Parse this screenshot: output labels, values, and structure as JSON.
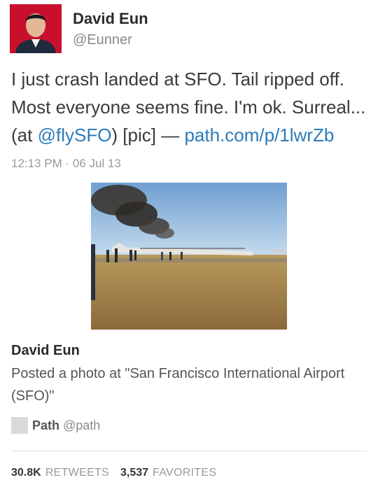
{
  "tweet": {
    "author_name": "David Eun",
    "author_handle": "@Eunner",
    "text_line1": "I just crash landed at SFO. Tail ripped off.",
    "text_line2": "Most everyone seems fine. I'm ok. Surreal...",
    "text_line3_prefix": "(at ",
    "mention": "@flySFO",
    "text_line3_middle": ") [pic] — ",
    "url": "path.com/p/1lwrZb",
    "timestamp": "12:13 PM · 06 Jul 13"
  },
  "card": {
    "author": "David Eun",
    "description_line1": "Posted a photo at \"San Francisco International Airport",
    "description_line2": "(SFO)\"",
    "source_name": "Path",
    "source_handle": "@path"
  },
  "stats": {
    "retweets_count": "30.8K",
    "retweets_label": "RETWEETS",
    "favorites_count": "3,537",
    "favorites_label": "FAVORITES"
  },
  "colors": {
    "link": "#2b7bb9",
    "avatar_bg": "#c8102e"
  },
  "icons": {
    "avatar": "profile-photo",
    "source": "path-app-icon"
  }
}
